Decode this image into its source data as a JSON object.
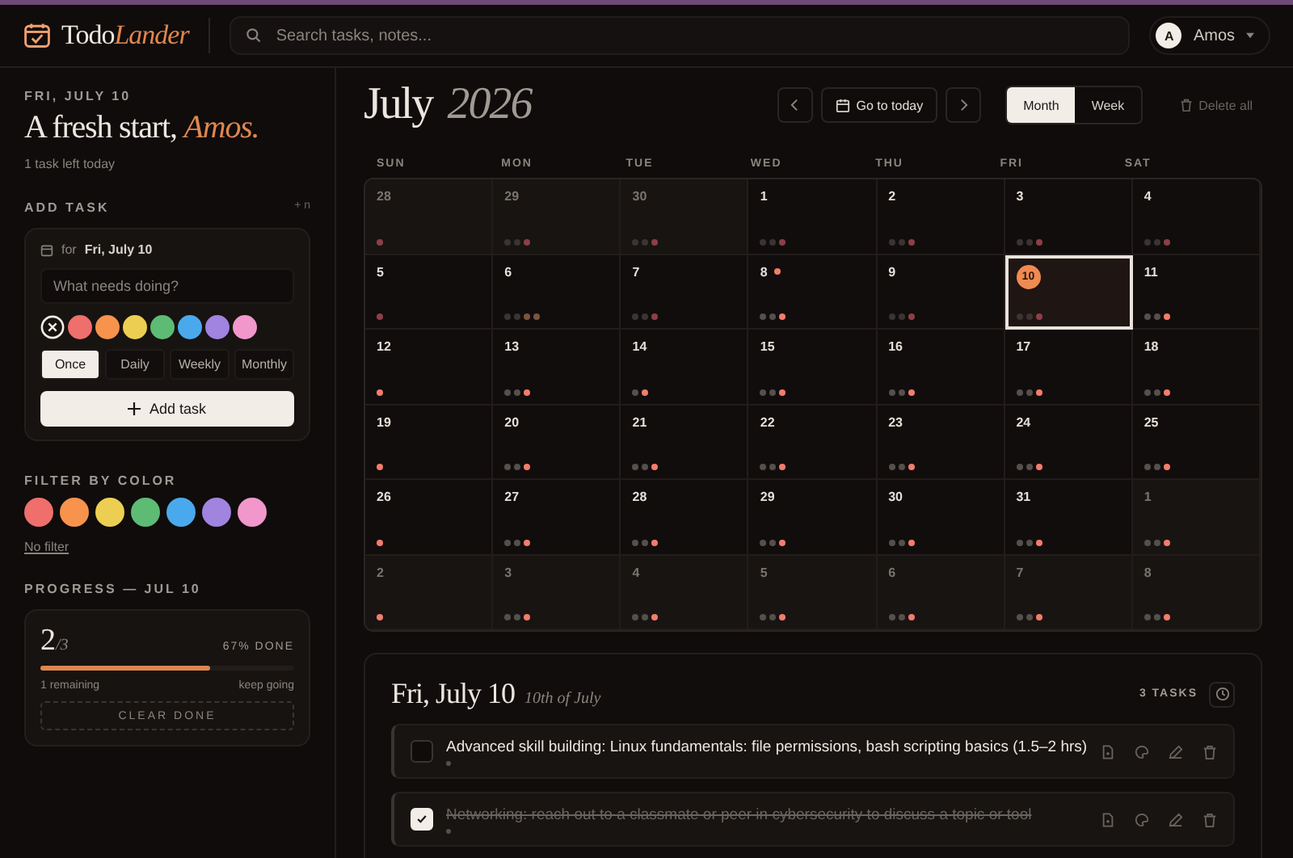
{
  "header": {
    "brand_main": "Todo",
    "brand_accent": "Lander",
    "search": {
      "placeholder": "Search tasks, notes..."
    },
    "user": {
      "initial": "A",
      "name": "Amos"
    }
  },
  "sidebar": {
    "date": "FRI, JULY 10",
    "greeting": "A fresh start,",
    "name": "Amos.",
    "subtitle": "1 task left today",
    "add_task": {
      "heading": "ADD TASK",
      "shortcut": "+ n",
      "for_label": "for",
      "for_date": "Fri, July 10",
      "input": {
        "placeholder": "What needs doing?"
      },
      "colors": [
        {
          "kind": "none",
          "selected": true
        },
        {
          "kind": "swatch",
          "color": "#ef6f6c",
          "selected": false
        },
        {
          "kind": "swatch",
          "color": "#f7934c",
          "selected": false
        },
        {
          "kind": "swatch",
          "color": "#eccf52",
          "selected": false
        },
        {
          "kind": "swatch",
          "color": "#5dbb74",
          "selected": false
        },
        {
          "kind": "swatch",
          "color": "#4aa9ec",
          "selected": false
        },
        {
          "kind": "swatch",
          "color": "#a183e0",
          "selected": false
        },
        {
          "kind": "swatch",
          "color": "#f197cc",
          "selected": false
        }
      ],
      "repeat": [
        {
          "label": "Once",
          "selected": true
        },
        {
          "label": "Daily",
          "selected": false
        },
        {
          "label": "Weekly",
          "selected": false
        },
        {
          "label": "Monthly",
          "selected": false
        }
      ],
      "button": "Add task"
    },
    "filter": {
      "heading": "FILTER BY COLOR",
      "colors": [
        {
          "color": "#ef6f6c"
        },
        {
          "color": "#f7934c"
        },
        {
          "color": "#eccf52"
        },
        {
          "color": "#5dbb74"
        },
        {
          "color": "#4aa9ec"
        },
        {
          "color": "#a183e0"
        },
        {
          "color": "#f197cc"
        }
      ],
      "clear": "No filter"
    },
    "progress": {
      "heading": "PROGRESS — JUL 10",
      "done": "2",
      "total": "/3",
      "percent": "67% DONE",
      "level": 0.67,
      "remaining": "1 remaining",
      "note": "keep going",
      "clear": "CLEAR DONE"
    }
  },
  "calendar": {
    "month": "July",
    "year": "2026",
    "today_button": "Go to today",
    "views": [
      {
        "label": "Month",
        "selected": true
      },
      {
        "label": "Week",
        "selected": false
      }
    ],
    "delete_all": "Delete all",
    "weekdays": [
      "SUN",
      "MON",
      "TUE",
      "WED",
      "THU",
      "FRI",
      "SAT"
    ],
    "weeks": [
      [
        {
          "day": "28",
          "muted": true,
          "selected": false,
          "marked": false,
          "dots": [
            {
              "color": "#8c3f48"
            }
          ]
        },
        {
          "day": "29",
          "muted": true,
          "selected": false,
          "marked": false,
          "dots": [
            {
              "color": "#3a3532"
            },
            {
              "color": "#3a3532"
            },
            {
              "color": "#8c3f48"
            }
          ]
        },
        {
          "day": "30",
          "muted": true,
          "selected": false,
          "marked": false,
          "dots": [
            {
              "color": "#3a3532"
            },
            {
              "color": "#3a3532"
            },
            {
              "color": "#8c3f48"
            }
          ]
        },
        {
          "day": "1",
          "muted": false,
          "selected": false,
          "marked": false,
          "dots": [
            {
              "color": "#3a3532"
            },
            {
              "color": "#3a3532"
            },
            {
              "color": "#8c3f48"
            }
          ]
        },
        {
          "day": "2",
          "muted": false,
          "selected": false,
          "marked": false,
          "dots": [
            {
              "color": "#3a3532"
            },
            {
              "color": "#3a3532"
            },
            {
              "color": "#8c3f48"
            }
          ]
        },
        {
          "day": "3",
          "muted": false,
          "selected": false,
          "marked": false,
          "dots": [
            {
              "color": "#3a3532"
            },
            {
              "color": "#3a3532"
            },
            {
              "color": "#8c3f48"
            }
          ]
        },
        {
          "day": "4",
          "muted": false,
          "selected": false,
          "marked": false,
          "dots": [
            {
              "color": "#3a3532"
            },
            {
              "color": "#3a3532"
            },
            {
              "color": "#8c3f48"
            }
          ]
        }
      ],
      [
        {
          "day": "5",
          "muted": false,
          "selected": false,
          "marked": false,
          "dots": [
            {
              "color": "#8c3f48"
            }
          ]
        },
        {
          "day": "6",
          "muted": false,
          "selected": false,
          "marked": false,
          "dots": [
            {
              "color": "#3a3532"
            },
            {
              "color": "#3a3532"
            },
            {
              "color": "#7a5540"
            },
            {
              "color": "#7a5540"
            }
          ]
        },
        {
          "day": "7",
          "muted": false,
          "selected": false,
          "marked": false,
          "dots": [
            {
              "color": "#3a3532"
            },
            {
              "color": "#3a3532"
            },
            {
              "color": "#8c3f48"
            }
          ]
        },
        {
          "day": "8",
          "muted": false,
          "selected": false,
          "marked": true,
          "dots": [
            {
              "color": "#55504c"
            },
            {
              "color": "#55504c"
            },
            {
              "color": "#f47c6c"
            }
          ]
        },
        {
          "day": "9",
          "muted": false,
          "selected": false,
          "marked": false,
          "dots": [
            {
              "color": "#3a3532"
            },
            {
              "color": "#3a3532"
            },
            {
              "color": "#8c3f48"
            }
          ]
        },
        {
          "day": "10",
          "muted": false,
          "selected": true,
          "marked": false,
          "dots": [
            {
              "color": "#3a3532"
            },
            {
              "color": "#3a3532"
            },
            {
              "color": "#8c3f48"
            }
          ]
        },
        {
          "day": "11",
          "muted": false,
          "selected": false,
          "marked": false,
          "dots": [
            {
              "color": "#55504c"
            },
            {
              "color": "#55504c"
            },
            {
              "color": "#f47c6c"
            }
          ]
        }
      ],
      [
        {
          "day": "12",
          "muted": false,
          "selected": false,
          "marked": false,
          "dots": [
            {
              "color": "#f47c6c"
            }
          ]
        },
        {
          "day": "13",
          "muted": false,
          "selected": false,
          "marked": false,
          "dots": [
            {
              "color": "#55504c"
            },
            {
              "color": "#55504c"
            },
            {
              "color": "#f47c6c"
            }
          ]
        },
        {
          "day": "14",
          "muted": false,
          "selected": false,
          "marked": false,
          "dots": [
            {
              "color": "#55504c"
            },
            {
              "color": "#f47c6c"
            }
          ]
        },
        {
          "day": "15",
          "muted": false,
          "selected": false,
          "marked": false,
          "dots": [
            {
              "color": "#55504c"
            },
            {
              "color": "#55504c"
            },
            {
              "color": "#f47c6c"
            }
          ]
        },
        {
          "day": "16",
          "muted": false,
          "selected": false,
          "marked": false,
          "dots": [
            {
              "color": "#55504c"
            },
            {
              "color": "#55504c"
            },
            {
              "color": "#f47c6c"
            }
          ]
        },
        {
          "day": "17",
          "muted": false,
          "selected": false,
          "marked": false,
          "dots": [
            {
              "color": "#55504c"
            },
            {
              "color": "#55504c"
            },
            {
              "color": "#f47c6c"
            }
          ]
        },
        {
          "day": "18",
          "muted": false,
          "selected": false,
          "marked": false,
          "dots": [
            {
              "color": "#55504c"
            },
            {
              "color": "#55504c"
            },
            {
              "color": "#f47c6c"
            }
          ]
        }
      ],
      [
        {
          "day": "19",
          "muted": false,
          "selected": false,
          "marked": false,
          "dots": [
            {
              "color": "#f47c6c"
            }
          ]
        },
        {
          "day": "20",
          "muted": false,
          "selected": false,
          "marked": false,
          "dots": [
            {
              "color": "#55504c"
            },
            {
              "color": "#55504c"
            },
            {
              "color": "#f47c6c"
            }
          ]
        },
        {
          "day": "21",
          "muted": false,
          "selected": false,
          "marked": false,
          "dots": [
            {
              "color": "#55504c"
            },
            {
              "color": "#55504c"
            },
            {
              "color": "#f47c6c"
            }
          ]
        },
        {
          "day": "22",
          "muted": false,
          "selected": false,
          "marked": false,
          "dots": [
            {
              "color": "#55504c"
            },
            {
              "color": "#55504c"
            },
            {
              "color": "#f47c6c"
            }
          ]
        },
        {
          "day": "23",
          "muted": false,
          "selected": false,
          "marked": false,
          "dots": [
            {
              "color": "#55504c"
            },
            {
              "color": "#55504c"
            },
            {
              "color": "#f47c6c"
            }
          ]
        },
        {
          "day": "24",
          "muted": false,
          "selected": false,
          "marked": false,
          "dots": [
            {
              "color": "#55504c"
            },
            {
              "color": "#55504c"
            },
            {
              "color": "#f47c6c"
            }
          ]
        },
        {
          "day": "25",
          "muted": false,
          "selected": false,
          "marked": false,
          "dots": [
            {
              "color": "#55504c"
            },
            {
              "color": "#55504c"
            },
            {
              "color": "#f47c6c"
            }
          ]
        }
      ],
      [
        {
          "day": "26",
          "muted": false,
          "selected": false,
          "marked": false,
          "dots": [
            {
              "color": "#f47c6c"
            }
          ]
        },
        {
          "day": "27",
          "muted": false,
          "selected": false,
          "marked": false,
          "dots": [
            {
              "color": "#55504c"
            },
            {
              "color": "#55504c"
            },
            {
              "color": "#f47c6c"
            }
          ]
        },
        {
          "day": "28",
          "muted": false,
          "selected": false,
          "marked": false,
          "dots": [
            {
              "color": "#55504c"
            },
            {
              "color": "#55504c"
            },
            {
              "color": "#f47c6c"
            }
          ]
        },
        {
          "day": "29",
          "muted": false,
          "selected": false,
          "marked": false,
          "dots": [
            {
              "color": "#55504c"
            },
            {
              "color": "#55504c"
            },
            {
              "color": "#f47c6c"
            }
          ]
        },
        {
          "day": "30",
          "muted": false,
          "selected": false,
          "marked": false,
          "dots": [
            {
              "color": "#55504c"
            },
            {
              "color": "#55504c"
            },
            {
              "color": "#f47c6c"
            }
          ]
        },
        {
          "day": "31",
          "muted": false,
          "selected": false,
          "marked": false,
          "dots": [
            {
              "color": "#55504c"
            },
            {
              "color": "#55504c"
            },
            {
              "color": "#f47c6c"
            }
          ]
        },
        {
          "day": "1",
          "muted": true,
          "selected": false,
          "marked": false,
          "dots": [
            {
              "color": "#55504c"
            },
            {
              "color": "#55504c"
            },
            {
              "color": "#f47c6c"
            }
          ]
        }
      ],
      [
        {
          "day": "2",
          "muted": true,
          "selected": false,
          "marked": false,
          "dots": [
            {
              "color": "#f47c6c"
            }
          ]
        },
        {
          "day": "3",
          "muted": true,
          "selected": false,
          "marked": false,
          "dots": [
            {
              "color": "#55504c"
            },
            {
              "color": "#55504c"
            },
            {
              "color": "#f47c6c"
            }
          ]
        },
        {
          "day": "4",
          "muted": true,
          "selected": false,
          "marked": false,
          "dots": [
            {
              "color": "#55504c"
            },
            {
              "color": "#55504c"
            },
            {
              "color": "#f47c6c"
            }
          ]
        },
        {
          "day": "5",
          "muted": true,
          "selected": false,
          "marked": false,
          "dots": [
            {
              "color": "#55504c"
            },
            {
              "color": "#55504c"
            },
            {
              "color": "#f47c6c"
            }
          ]
        },
        {
          "day": "6",
          "muted": true,
          "selected": false,
          "marked": false,
          "dots": [
            {
              "color": "#55504c"
            },
            {
              "color": "#55504c"
            },
            {
              "color": "#f47c6c"
            }
          ]
        },
        {
          "day": "7",
          "muted": true,
          "selected": false,
          "marked": false,
          "dots": [
            {
              "color": "#55504c"
            },
            {
              "color": "#55504c"
            },
            {
              "color": "#f47c6c"
            }
          ]
        },
        {
          "day": "8",
          "muted": true,
          "selected": false,
          "marked": false,
          "dots": [
            {
              "color": "#55504c"
            },
            {
              "color": "#55504c"
            },
            {
              "color": "#f47c6c"
            }
          ]
        }
      ]
    ]
  },
  "day_panel": {
    "title": "Fri, July 10",
    "subtitle": "10th of July",
    "count": "3 TASKS",
    "tasks": [
      {
        "text": "Advanced skill building: Linux fundamentals: file permissions, bash scripting basics (1.5–2 hrs)",
        "checked": false,
        "color": "#55504c"
      },
      {
        "text": "Networking: reach out to a classmate or peer in cybersecurity to discuss a topic or tool",
        "checked": true,
        "color": "#55504c"
      }
    ]
  }
}
